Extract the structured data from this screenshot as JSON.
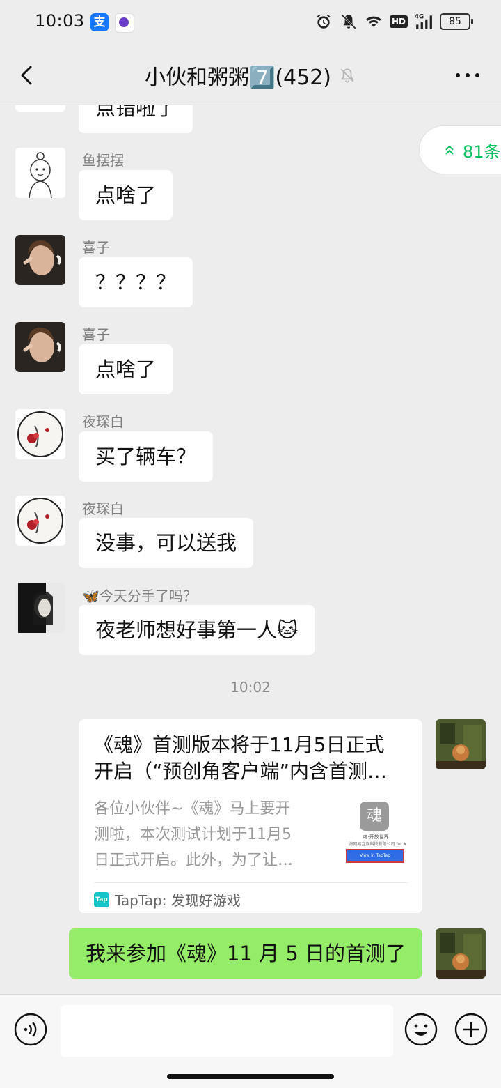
{
  "status_bar": {
    "time": "10:03",
    "alipay_glyph": "支",
    "hd_label": "HD",
    "network_label": "4G",
    "battery": "85"
  },
  "nav": {
    "title": "小伙和粥粥7️⃣(452)",
    "back_icon": "chevron-left-icon",
    "mute_icon": "bell-off-icon",
    "more_icon": "more-dots-icon"
  },
  "jump_pill": {
    "label": "81条",
    "icon": "double-chevron-up-icon",
    "color": "#07c160"
  },
  "messages": [
    {
      "sender": "",
      "text": "点错啦了"
    },
    {
      "sender": "鱼摆摆",
      "text": "点啥了"
    },
    {
      "sender": "喜子",
      "text": "？？？？"
    },
    {
      "sender": "喜子",
      "text": "点啥了"
    },
    {
      "sender": "夜琛白",
      "text": "买了辆车？"
    },
    {
      "sender": "夜琛白",
      "text": "没事，可以送我"
    },
    {
      "sender": "🦋今天分手了吗？",
      "text": "夜老师想好事第一人🐱"
    }
  ],
  "timestamp": "10:02",
  "link_card": {
    "title_line1": "《魂》首测版本将于11月5日正式",
    "title_line2": "开启（“预创角客户端”内含首测…",
    "desc_line1": "各位小伙伴~《魂》马上要开",
    "desc_line2": "测啦，本次测试计划于11月5",
    "desc_line3": "日正式开启。此外，为了让…",
    "source": "TapTap: 发现好游戏",
    "thumb_logo": "魂",
    "thumb_caption": "魂·开放世界",
    "thumb_company": "上海网易互娱科技有限公司 for #",
    "thumb_button": "View in TapTap",
    "tap_logo_text": "Tap"
  },
  "own_message": "我来参加《魂》11 月 5 日的首测了",
  "colors": {
    "background": "#ededed",
    "bubble_white": "#ffffff",
    "bubble_green": "#95ec69",
    "accent": "#07c160"
  },
  "input_bar": {
    "placeholder": "",
    "voice_icon": "voice-icon",
    "emoji_icon": "emoji-icon",
    "plus_icon": "plus-circle-icon"
  }
}
